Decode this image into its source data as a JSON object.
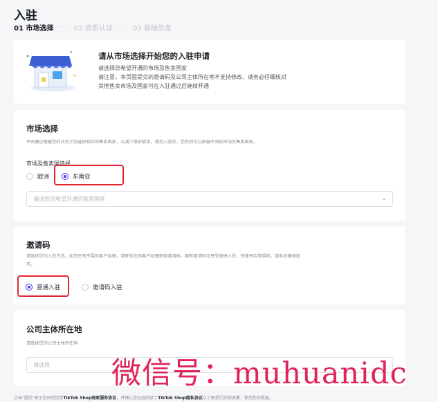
{
  "page": {
    "title": "入驻"
  },
  "steps": [
    "01 市场选择",
    "02 资质认证",
    "03 基础信息"
  ],
  "intro": {
    "title": "请从市场选择开始您的入驻申请",
    "lines": [
      "请选择您希望开通的市场及售卖国家",
      "请注意，本页面提交的邀请码及公司主体所在地不支持修改，请务必仔细核对",
      "其他售卖市场及国家可在入驻通过后继续开通"
    ]
  },
  "market": {
    "title": "市场选择",
    "desc": "平台建议根据您的业务计划选择相应的售卖国家，以减少维护成本。成功入驻后，您仍然可以拓展不同的市场及售卖国家。",
    "sub_label": "市场及售卖国选择",
    "options": [
      "欧洲",
      "东南亚"
    ],
    "selected": "东南亚",
    "country_placeholder": "请选择您希望开通的售卖国家"
  },
  "invite": {
    "title": "邀请码",
    "desc_line1": "请选择您的入驻方式。如您已有专属的客户经理，请联系您的客户经理获取邀请码。拥有邀请码可享受便捷入驻、快速开店等福利，请务必确保填",
    "desc_line2": "写。",
    "options": [
      "普通入驻",
      "邀请码入驻"
    ],
    "selected": "普通入驻"
  },
  "company": {
    "title": "公司主体所在地",
    "desc": "请选择您的公司主体所在地",
    "placeholder": "请选择"
  },
  "footer": {
    "pre": "点击\"提交\"表示您同意接受",
    "link1": "TikTok Shop商家服务协议",
    "mid": "，并确认您已经阅读了",
    "link2": "TikTok Shop隐私协议",
    "post": "以了解我们如何收集、使用您的数据。"
  },
  "watermark": "微信号：muhuanidc",
  "colors": {
    "accent": "#3c3df0",
    "highlight": "#e0252f",
    "watermark": "#e0245a"
  }
}
